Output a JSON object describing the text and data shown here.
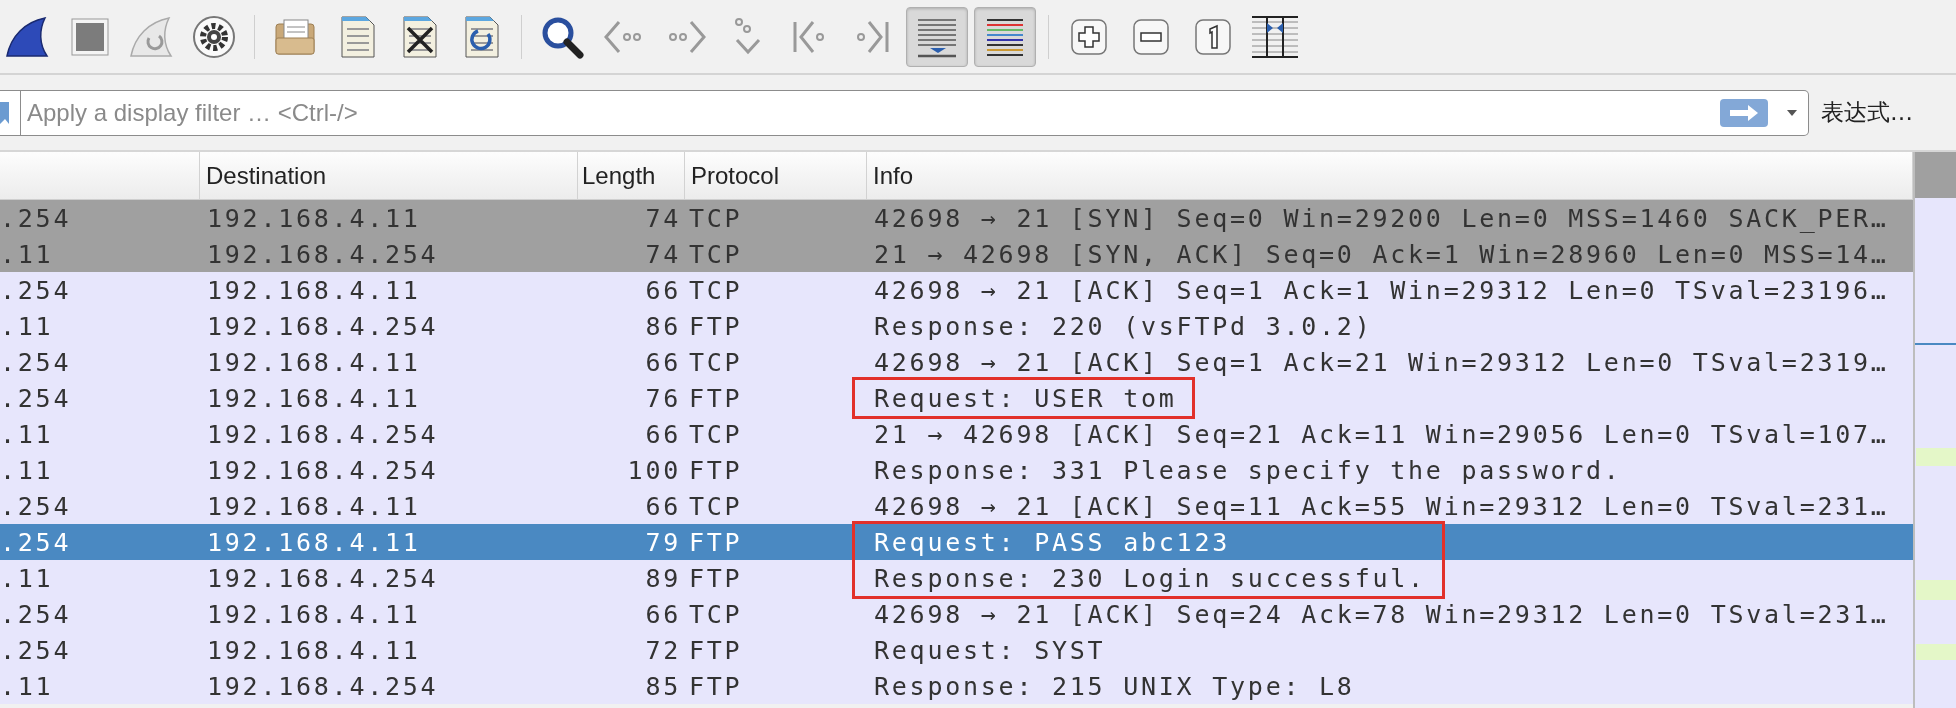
{
  "toolbar": {
    "buttons": [
      {
        "pressed": false
      },
      {
        "pressed": false
      },
      {
        "pressed": false
      },
      {
        "pressed": false
      },
      {
        "pressed": false
      },
      {
        "pressed": false
      },
      {
        "pressed": false
      },
      {
        "pressed": false
      },
      {
        "pressed": false
      },
      {
        "pressed": false
      },
      {
        "pressed": false
      },
      {
        "pressed": false
      },
      {
        "pressed": false
      },
      {
        "pressed": false
      },
      {
        "pressed": true
      },
      {
        "pressed": true
      },
      {
        "pressed": false
      },
      {
        "pressed": false
      },
      {
        "pressed": false
      },
      {
        "pressed": false
      }
    ]
  },
  "filter": {
    "placeholder": "Apply a display filter … <Ctrl-/>",
    "expression_button": "表达式…"
  },
  "table": {
    "columns": [
      "",
      "Destination",
      "Length",
      "Protocol",
      "Info"
    ],
    "rows": [
      {
        "cells": [
          ".254",
          "192.168.4.11",
          "74",
          "TCP",
          "42698 → 21 [SYN] Seq=0 Win=29200 Len=0 MSS=1460 SACK_PER…"
        ],
        "color": "#a0a0a0",
        "selected": false,
        "marked": false
      },
      {
        "cells": [
          ".11",
          "192.168.4.254",
          "74",
          "TCP",
          "21 → 42698 [SYN, ACK] Seq=0 Ack=1 Win=28960 Len=0 MSS=14…"
        ],
        "color": "#a0a0a0",
        "selected": false,
        "marked": false
      },
      {
        "cells": [
          ".254",
          "192.168.4.11",
          "66",
          "TCP",
          "42698 → 21 [ACK] Seq=1 Ack=1 Win=29312 Len=0 TSval=23196…"
        ],
        "color": "#e7e6fc",
        "selected": false,
        "marked": false
      },
      {
        "cells": [
          ".11",
          "192.168.4.254",
          "86",
          "FTP",
          "Response: 220 (vsFTPd 3.0.2)"
        ],
        "color": "#e7e6fc",
        "selected": false,
        "marked": false
      },
      {
        "cells": [
          ".254",
          "192.168.4.11",
          "66",
          "TCP",
          "42698 → 21 [ACK] Seq=1 Ack=21 Win=29312 Len=0 TSval=2319…"
        ],
        "color": "#e7e6fc",
        "selected": false,
        "marked": false
      },
      {
        "cells": [
          ".254",
          "192.168.4.11",
          "76",
          "FTP",
          "Request: USER tom"
        ],
        "color": "#e7e6fc",
        "selected": false,
        "marked": true
      },
      {
        "cells": [
          ".11",
          "192.168.4.254",
          "66",
          "TCP",
          "21 → 42698 [ACK] Seq=21 Ack=11 Win=29056 Len=0 TSval=107…"
        ],
        "color": "#e7e6fc",
        "selected": false,
        "marked": false
      },
      {
        "cells": [
          ".11",
          "192.168.4.254",
          "100",
          "FTP",
          "Response: 331 Please specify the password."
        ],
        "color": "#e7e6fc",
        "selected": false,
        "marked": false
      },
      {
        "cells": [
          ".254",
          "192.168.4.11",
          "66",
          "TCP",
          "42698 → 21 [ACK] Seq=11 Ack=55 Win=29312 Len=0 TSval=231…"
        ],
        "color": "#e7e6fc",
        "selected": false,
        "marked": false
      },
      {
        "cells": [
          ".254",
          "192.168.4.11",
          "79",
          "FTP",
          "Request: PASS abc123"
        ],
        "selected": true,
        "marked": true
      },
      {
        "cells": [
          ".11",
          "192.168.4.254",
          "89",
          "FTP",
          "Response: 230 Login successful."
        ],
        "color": "#e7e6fc",
        "selected": false,
        "marked": true
      },
      {
        "cells": [
          ".254",
          "192.168.4.11",
          "66",
          "TCP",
          "42698 → 21 [ACK] Seq=24 Ack=78 Win=29312 Len=0 TSval=231…"
        ],
        "color": "#e7e6fc",
        "selected": false,
        "marked": false
      },
      {
        "cells": [
          ".254",
          "192.168.4.11",
          "72",
          "FTP",
          "Request: SYST"
        ],
        "color": "#e7e6fc",
        "selected": false,
        "marked": false
      },
      {
        "cells": [
          ".11",
          "192.168.4.254",
          "85",
          "FTP",
          "Response: 215 UNIX Type: L8"
        ],
        "color": "#e7e6fc",
        "selected": false,
        "marked": false
      }
    ]
  }
}
